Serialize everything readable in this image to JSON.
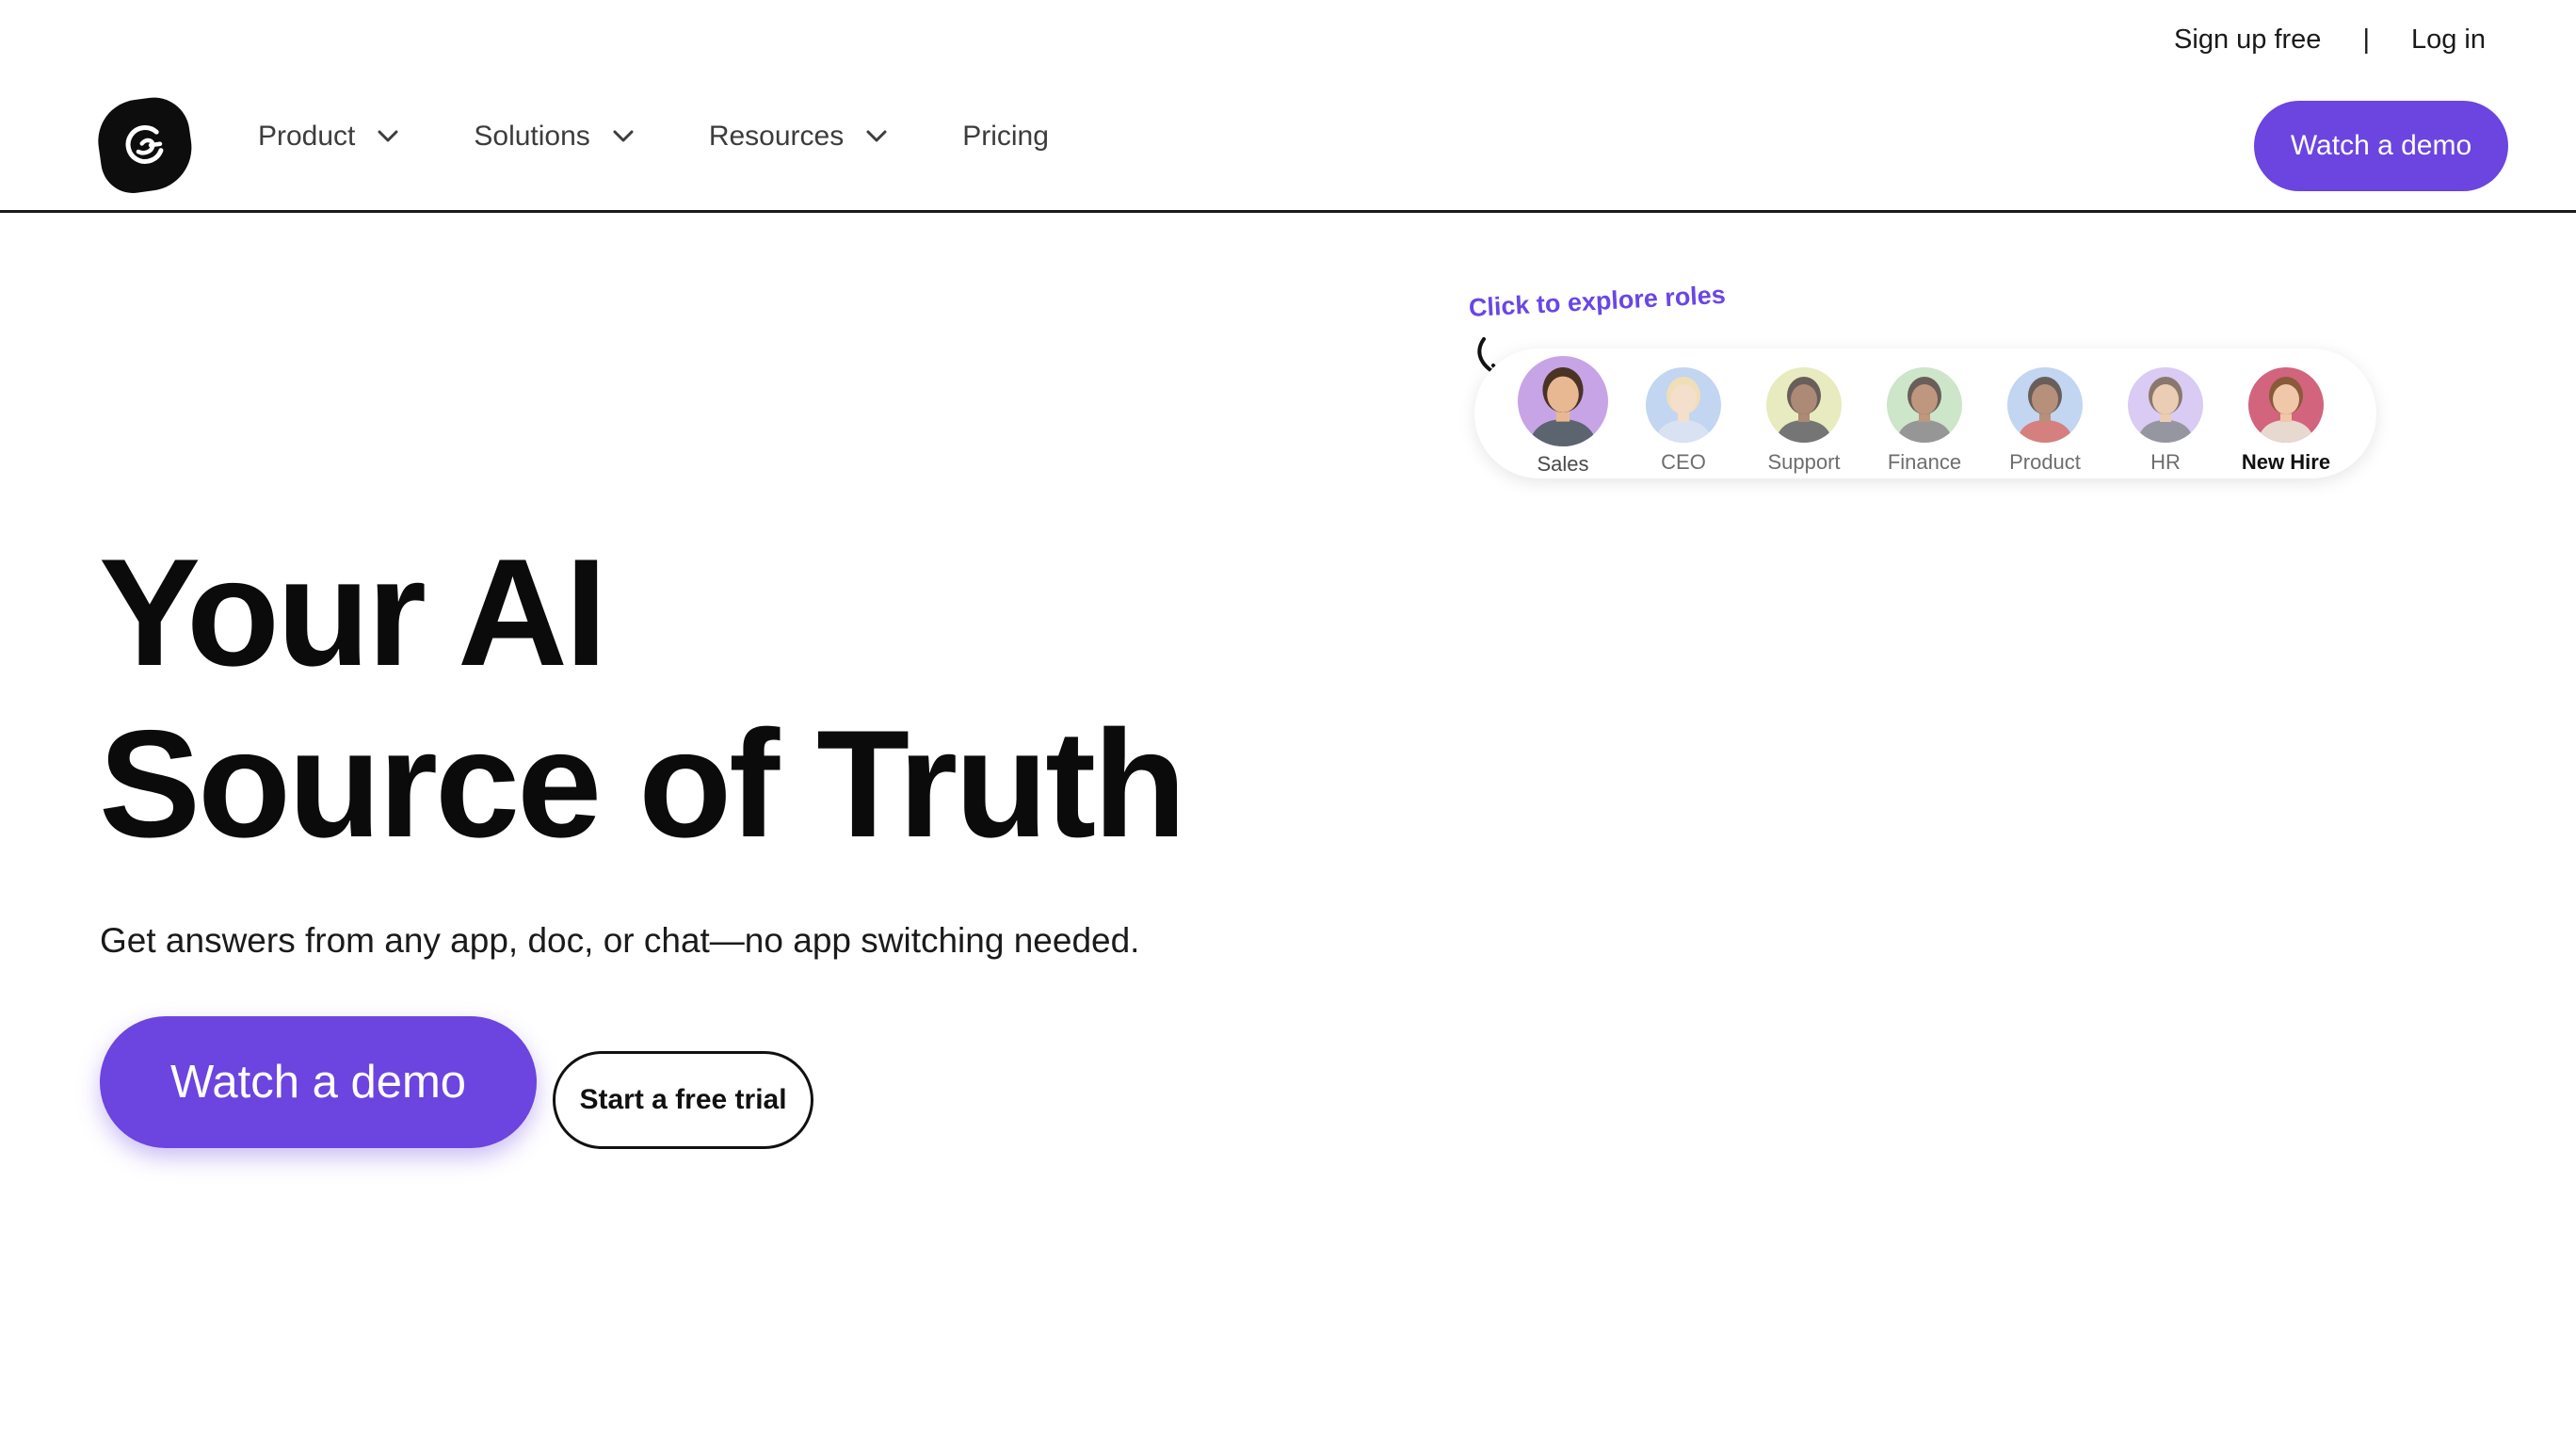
{
  "utility": {
    "signup": "Sign up free",
    "separator": "|",
    "login": "Log in"
  },
  "nav": {
    "items": [
      {
        "label": "Product",
        "has_dropdown": true
      },
      {
        "label": "Solutions",
        "has_dropdown": true
      },
      {
        "label": "Resources",
        "has_dropdown": true
      },
      {
        "label": "Pricing",
        "has_dropdown": false
      }
    ],
    "cta": "Watch a demo"
  },
  "hero": {
    "title_line1": "Your AI",
    "title_line2": "Source of Truth",
    "subtitle": "Get answers from any app, doc, or chat—no app switching needed.",
    "primary_cta": "Watch a demo",
    "secondary_cta": "Start a free trial"
  },
  "roles": {
    "hint": "Click to explore roles",
    "items": [
      {
        "label": "Sales",
        "bg": "#c7a4e6",
        "skin": "#e8b892",
        "hair": "#4a3325",
        "shirt": "#5c6470"
      },
      {
        "label": "CEO",
        "bg": "#a9c4ec",
        "skin": "#f0d2b8",
        "hair": "#e9d29a",
        "shirt": "#c9d6ee"
      },
      {
        "label": "Support",
        "bg": "#dfe3a4",
        "skin": "#8a5a3c",
        "hair": "#2a1b14",
        "shirt": "#3b3b3b"
      },
      {
        "label": "Finance",
        "bg": "#b9dbb3",
        "skin": "#a56b48",
        "hair": "#2a1b14",
        "shirt": "#6b6b6b"
      },
      {
        "label": "Product",
        "bg": "#a9c4ec",
        "skin": "#9a6246",
        "hair": "#2a1b14",
        "shirt": "#c44a4a"
      },
      {
        "label": "HR",
        "bg": "#c9b6ee",
        "skin": "#e3b896",
        "hair": "#5a4030",
        "shirt": "#6a6a7a"
      },
      {
        "label": "New Hire",
        "bg": "#d2647e",
        "skin": "#f0c7a8",
        "hair": "#8a5a3a",
        "shirt": "#e7d8d0"
      }
    ]
  },
  "colors": {
    "accent": "#6c44e0",
    "text": "#0b0b0b"
  }
}
